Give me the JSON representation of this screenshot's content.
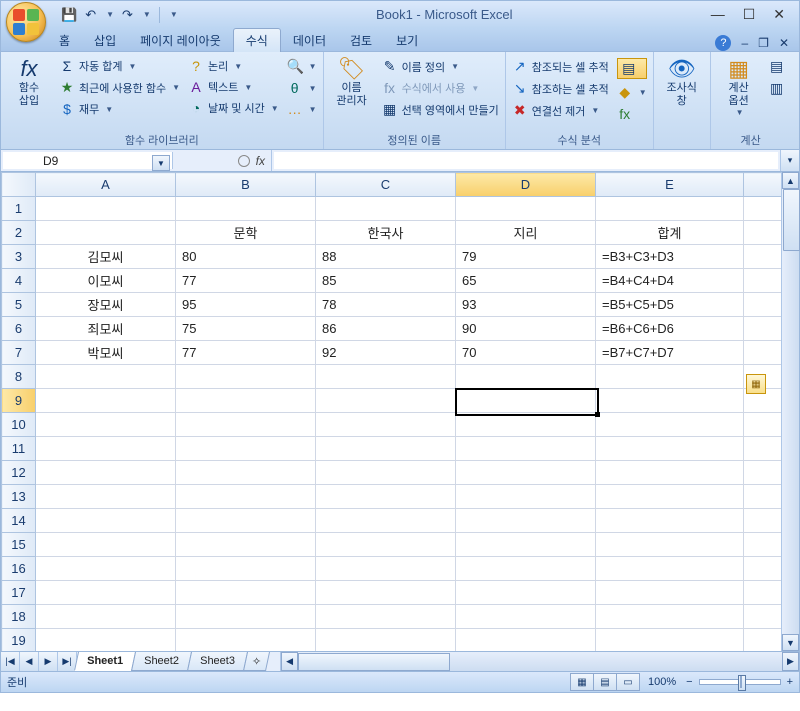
{
  "app": {
    "title": "Book1 - Microsoft Excel",
    "window": {
      "minimize": "—",
      "maximize": "☐",
      "close": "✕"
    },
    "qat": {
      "save": "💾",
      "undo": "↶",
      "redo": "↷"
    }
  },
  "tabs": {
    "items": [
      "홈",
      "삽입",
      "페이지 레이아웃",
      "수식",
      "데이터",
      "검토",
      "보기"
    ],
    "active_index": 3,
    "help_icon": "?",
    "min": "–",
    "restore": "❐",
    "x": "✕"
  },
  "ribbon": {
    "group1": {
      "label": "함수 라이브러리",
      "insertfn": "함수\n삽입",
      "autosum": "자동 합계",
      "recent": "최근에 사용한 함수",
      "financial": "재무",
      "logical": "논리",
      "text": "텍스트",
      "datetime": "날짜 및 시간",
      "lookup": "",
      "math": "",
      "more": ""
    },
    "group2": {
      "label": "정의된 이름",
      "name_mgr": "이름\n관리자",
      "define": "이름 정의",
      "use": "수식에서 사용",
      "create": "선택 영역에서 만들기"
    },
    "group3": {
      "label": "수식 분석",
      "precedents": "참조되는 셀 추적",
      "dependents": "참조하는 셀 추적",
      "remove": "연결선 제거"
    },
    "group4": {
      "label": "",
      "watch": "조사식\n창"
    },
    "group5": {
      "label": "계산",
      "calc": "계산\n옵션"
    }
  },
  "namebox": {
    "value": "D9"
  },
  "formula": {
    "value": ""
  },
  "grid": {
    "columns": [
      "A",
      "B",
      "C",
      "D",
      "E"
    ],
    "active_col_index": 3,
    "active_row": 9,
    "visible_rows": 20,
    "headers_row": {
      "B": "문학",
      "C": "한국사",
      "D": "지리",
      "E": "합계"
    },
    "data": [
      {
        "A": "김모씨",
        "B": "80",
        "C": "88",
        "D": "79",
        "E": "=B3+C3+D3"
      },
      {
        "A": "이모씨",
        "B": "77",
        "C": "85",
        "D": "65",
        "E": "=B4+C4+D4"
      },
      {
        "A": "장모씨",
        "B": "95",
        "C": "78",
        "D": "93",
        "E": "=B5+C5+D5"
      },
      {
        "A": "죄모씨",
        "B": "75",
        "C": "86",
        "D": "90",
        "E": "=B6+C6+D6"
      },
      {
        "A": "박모씨",
        "B": "77",
        "C": "92",
        "D": "70",
        "E": "=B7+C7+D7"
      }
    ]
  },
  "sheets": {
    "items": [
      "Sheet1",
      "Sheet2",
      "Sheet3"
    ],
    "active_index": 0
  },
  "status": {
    "ready": "준비",
    "zoom": "100%"
  }
}
